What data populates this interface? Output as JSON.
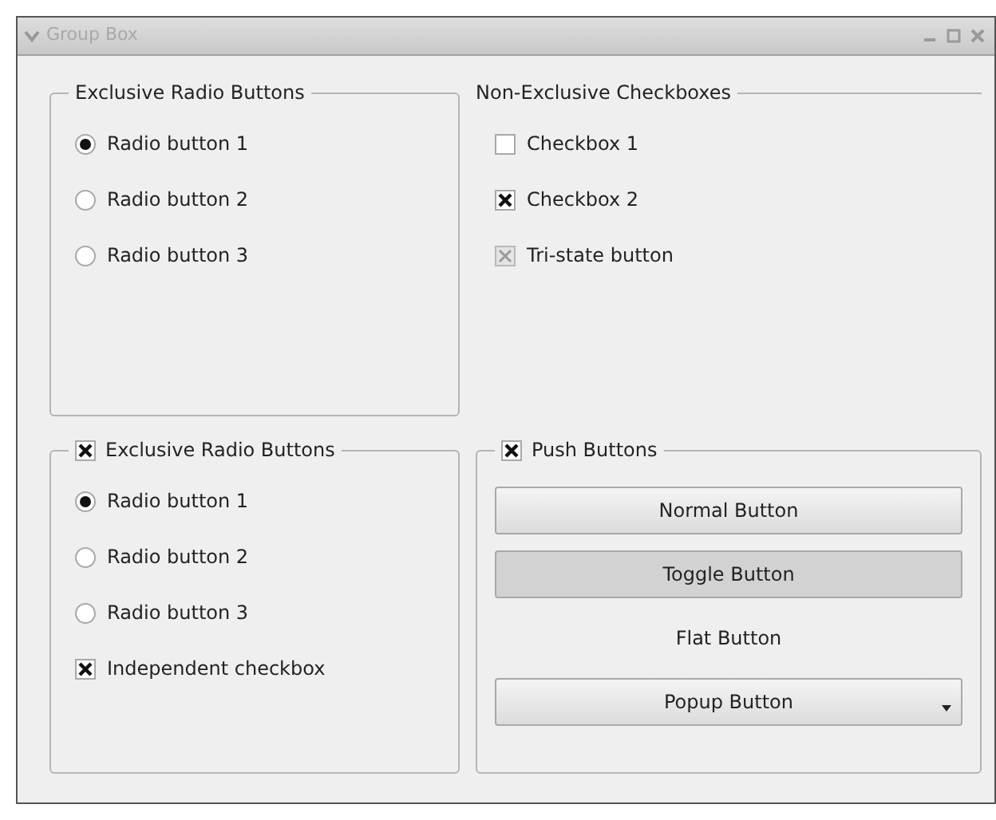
{
  "window": {
    "title": "Group Box"
  },
  "groups": [
    {
      "title": "Exclusive Radio Buttons",
      "flat": false,
      "items": [
        {
          "kind": "radio",
          "label": "Radio button 1",
          "checked": true
        },
        {
          "kind": "radio",
          "label": "Radio button 2",
          "checked": false
        },
        {
          "kind": "radio",
          "label": "Radio button 3",
          "checked": false
        }
      ]
    },
    {
      "title": "Non-Exclusive Checkboxes",
      "flat": true,
      "items": [
        {
          "kind": "checkbox",
          "label": "Checkbox 1",
          "checked": false
        },
        {
          "kind": "checkbox",
          "label": "Checkbox 2",
          "checked": true
        },
        {
          "kind": "tristate",
          "label": "Tri-state button",
          "partial": true
        }
      ]
    },
    {
      "title": "Exclusive Radio Buttons",
      "flat": false,
      "checked": true,
      "items": [
        {
          "kind": "radio",
          "label": "Radio button 1",
          "checked": true
        },
        {
          "kind": "radio",
          "label": "Radio button 2",
          "checked": false
        },
        {
          "kind": "radio",
          "label": "Radio button 3",
          "checked": false
        },
        {
          "kind": "checkbox",
          "label": "Independent checkbox",
          "checked": true
        }
      ]
    },
    {
      "title": "Push Buttons",
      "flat": false,
      "checked": true,
      "items": [
        {
          "kind": "button",
          "label": "Normal Button"
        },
        {
          "kind": "toggle",
          "label": "Toggle Button",
          "pressed": true
        },
        {
          "kind": "flat",
          "label": "Flat Button"
        },
        {
          "kind": "popup",
          "label": "Popup Button"
        }
      ]
    }
  ]
}
